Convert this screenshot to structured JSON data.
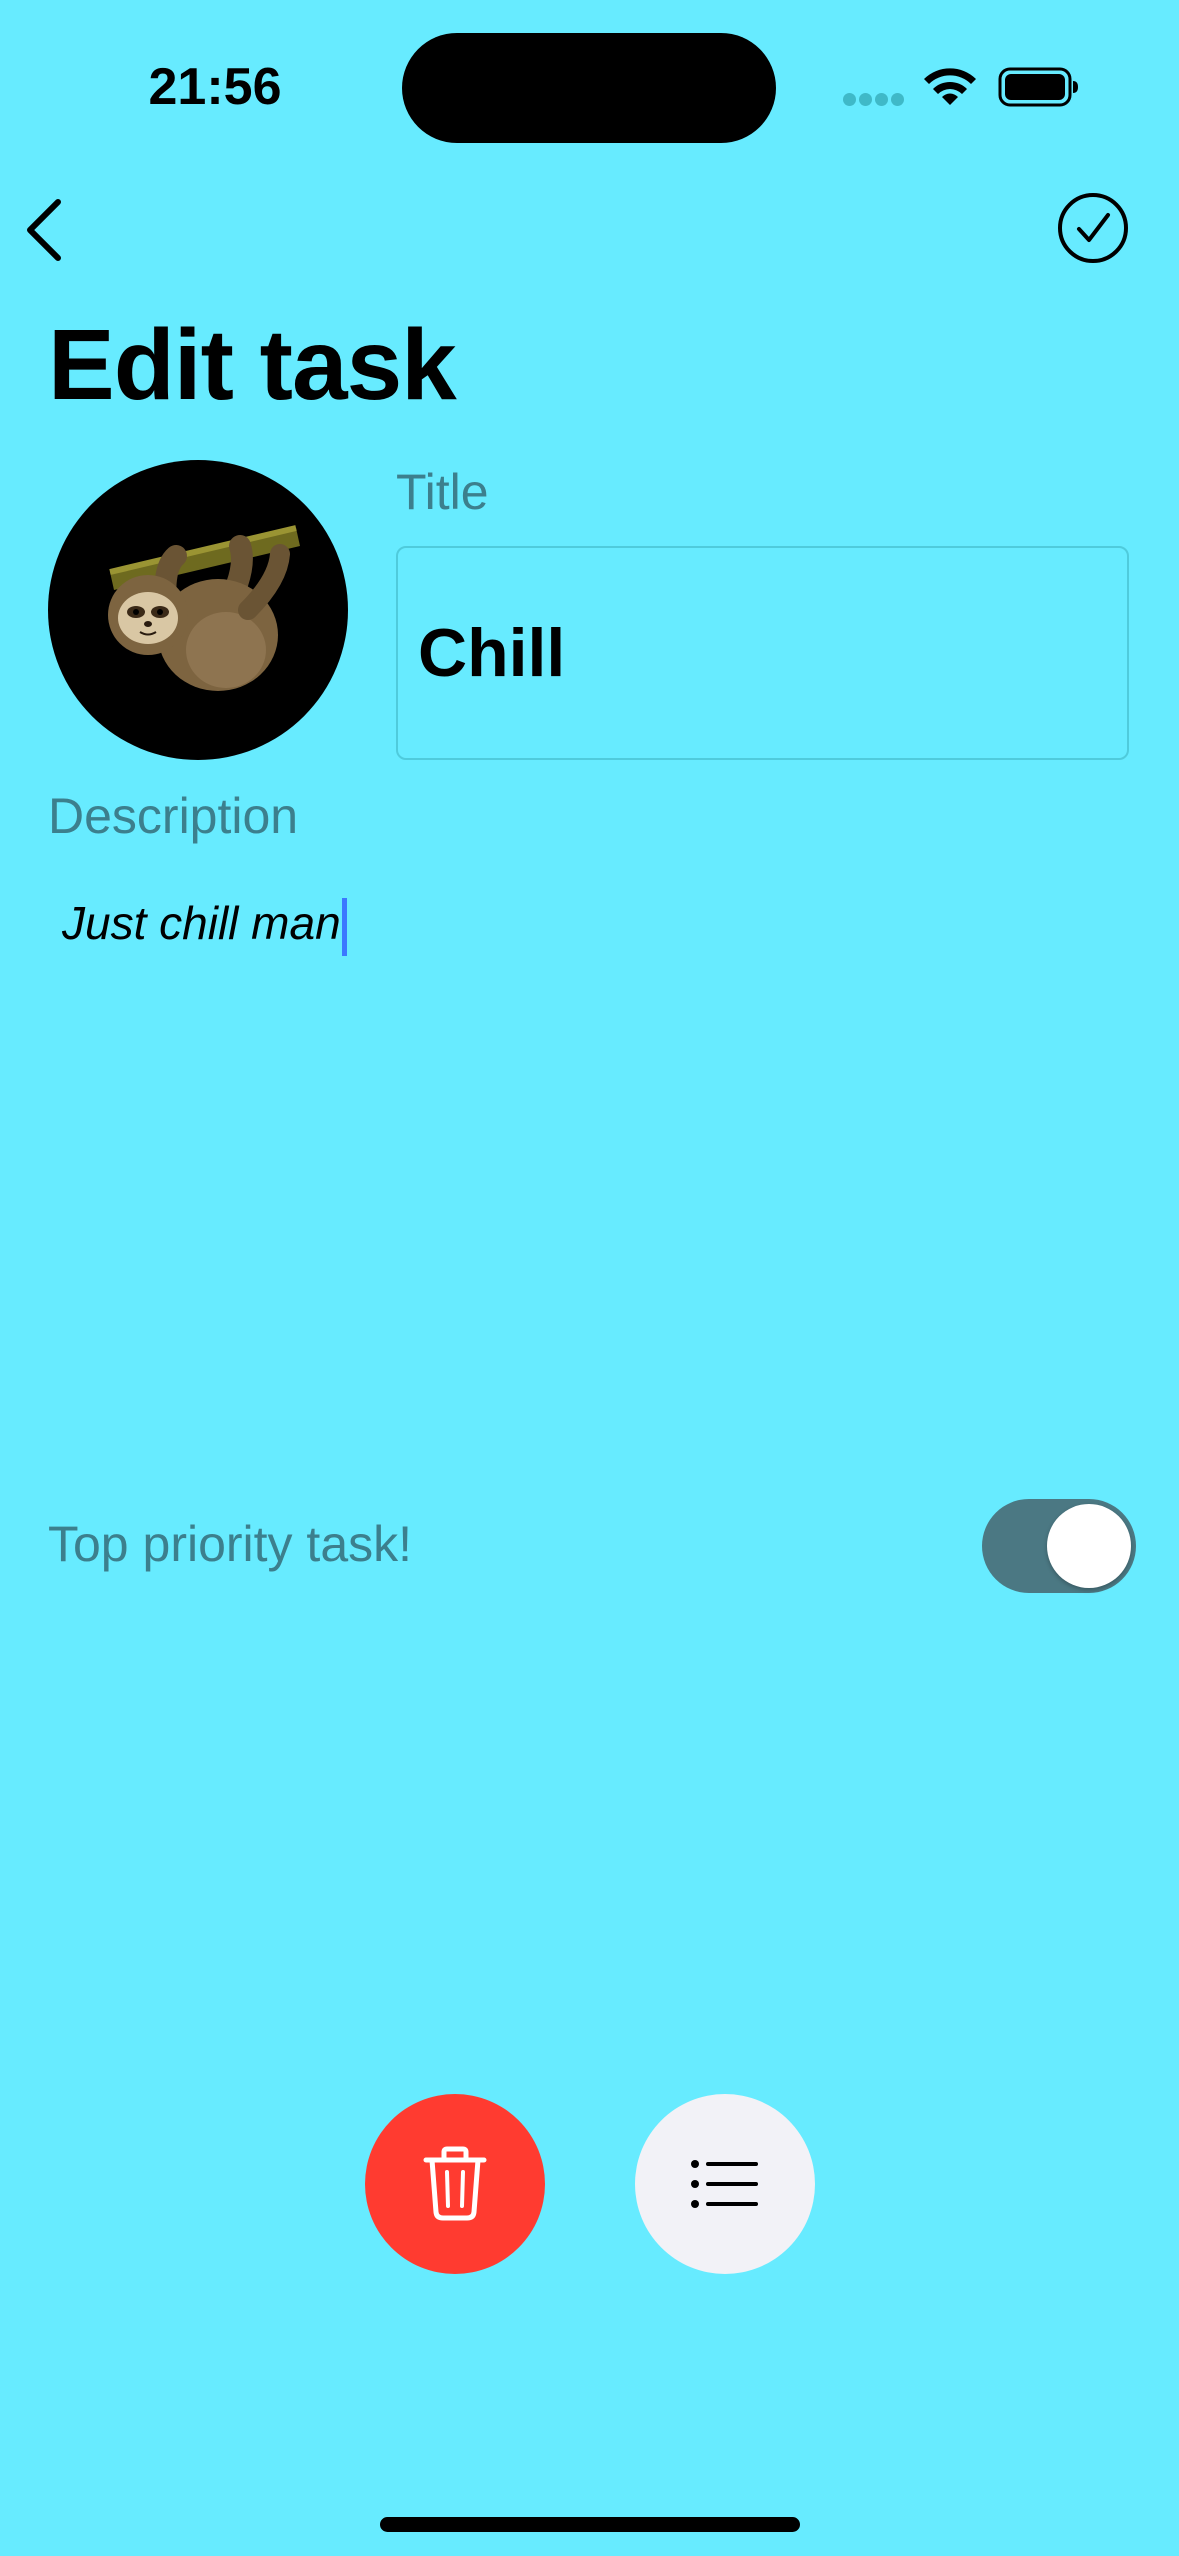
{
  "status_bar": {
    "time": "21:56"
  },
  "nav": {
    "back_icon": "chevron-left-icon",
    "confirm_icon": "checkmark-circle-icon"
  },
  "page": {
    "title": "Edit task"
  },
  "form": {
    "avatar_emoji": "sloth",
    "title_label": "Title",
    "title_value": "Chill",
    "description_label": "Description",
    "description_value": "Just chill man",
    "priority_label": "Top priority task!",
    "priority_enabled": true
  },
  "actions": {
    "delete_icon": "trash-icon",
    "list_icon": "list-bullet-icon"
  },
  "colors": {
    "background": "#67EBFF",
    "delete": "#FF3B30",
    "toggle_on": "#4B7883",
    "label": "#3C7F8D"
  }
}
